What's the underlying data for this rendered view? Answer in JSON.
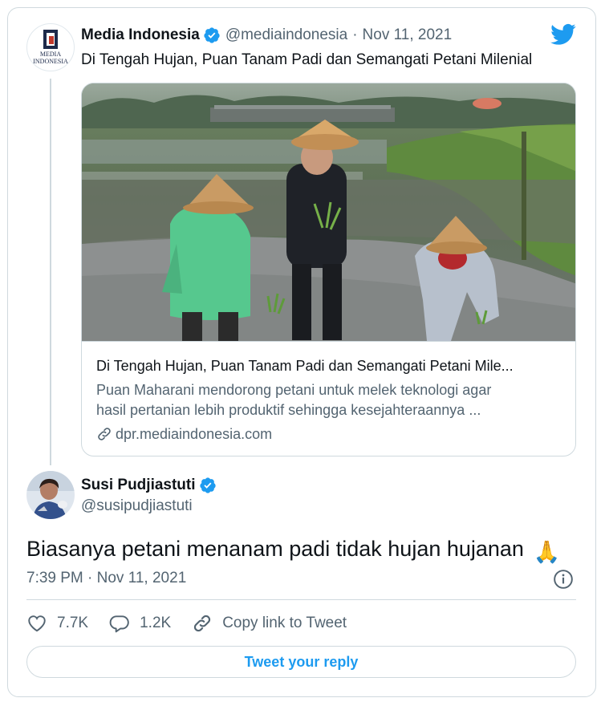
{
  "parent_tweet": {
    "author_name": "Media Indonesia",
    "handle": "@mediaindonesia",
    "separator": "·",
    "date": "Nov 11, 2021",
    "avatar_text": "MEDIA INDONESIA",
    "text": "Di Tengah Hujan, Puan Tanam Padi dan Semangati Petani Milenial",
    "link_card": {
      "title": "Di Tengah Hujan, Puan Tanam Padi dan Semangati Petani Mile...",
      "description_line1": "Puan Maharani mendorong petani untuk melek teknologi agar",
      "description_line2": "hasil pertanian lebih produktif sehingga kesejahteraannya ...",
      "domain": "dpr.mediaindonesia.com",
      "image": "rice-field-farmers-photo"
    }
  },
  "tweet": {
    "author_name": "Susi Pudjiastuti",
    "handle": "@susipudjiastuti",
    "text": "Biasanya petani menanam padi tidak hujan hujanan",
    "emoji": "🙏",
    "time_date": "7:39 PM · Nov 11, 2021"
  },
  "actions": {
    "likes": "7.7K",
    "replies": "1.2K",
    "copy_link": "Copy link to Tweet"
  },
  "reply_button": "Tweet your reply",
  "icons": [
    "twitter-bird-icon",
    "verified-badge-icon",
    "link-icon",
    "info-icon",
    "heart-icon",
    "reply-icon",
    "copy-link-icon"
  ],
  "colors": {
    "accent": "#1d9bf0",
    "text": "#0f1419",
    "muted": "#536471",
    "border": "#cfd9de"
  }
}
